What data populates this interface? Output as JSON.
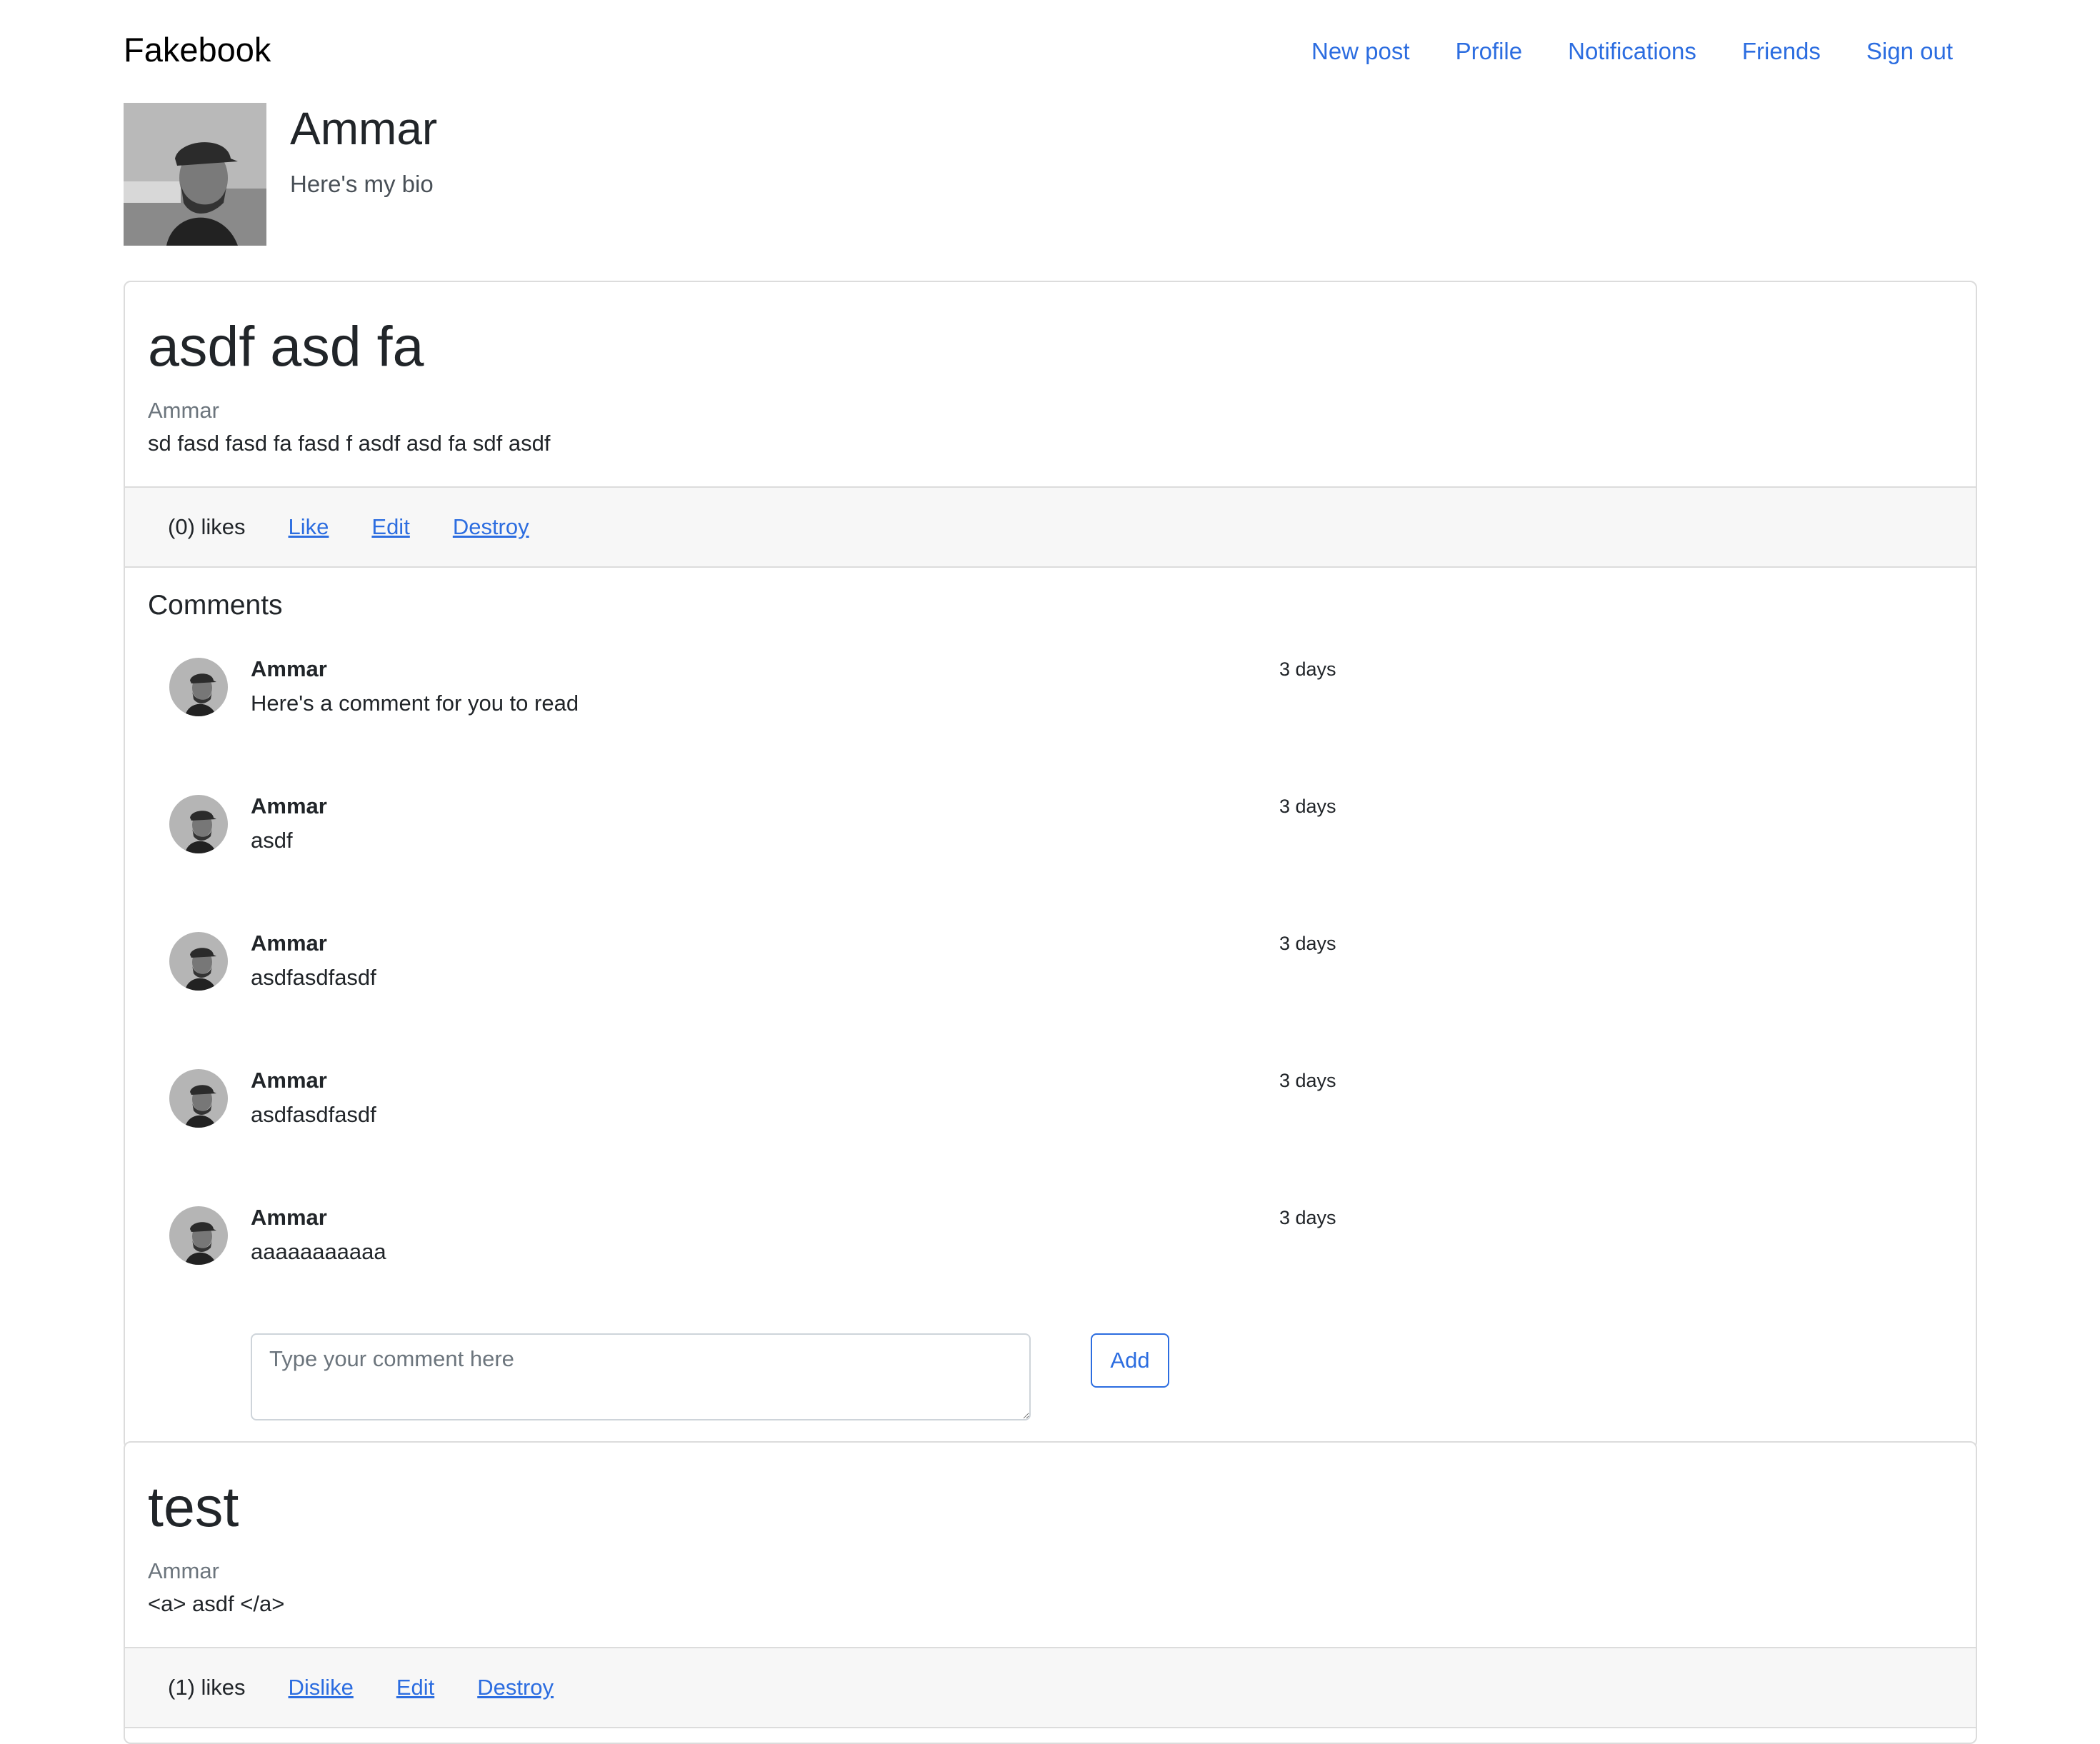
{
  "navbar": {
    "brand": "Fakebook",
    "links": [
      "New post",
      "Profile",
      "Notifications",
      "Friends",
      "Sign out"
    ]
  },
  "profile": {
    "name": "Ammar",
    "bio": "Here's my bio"
  },
  "posts": [
    {
      "title": "asdf asd fa",
      "author": "Ammar",
      "body": "sd fasd fasd fa fasd f asdf asd fa sdf asdf",
      "likes": "(0) likes",
      "actions": [
        "Like",
        "Edit",
        "Destroy"
      ],
      "comments_title": "Comments",
      "comments": [
        {
          "author": "Ammar",
          "text": "Here's a comment for you to read",
          "time": "3 days"
        },
        {
          "author": "Ammar",
          "text": "asdf",
          "time": "3 days"
        },
        {
          "author": "Ammar",
          "text": "asdfasdfasdf",
          "time": "3 days"
        },
        {
          "author": "Ammar",
          "text": "asdfasdfasdf",
          "time": "3 days"
        },
        {
          "author": "Ammar",
          "text": "aaaaaaaaaaa",
          "time": "3 days"
        }
      ],
      "comment_placeholder": "Type your comment here",
      "add_label": "Add"
    },
    {
      "title": "test",
      "author": "Ammar",
      "body": "<a> asdf </a>",
      "likes": "(1) likes",
      "actions": [
        "Dislike",
        "Edit",
        "Destroy"
      ]
    }
  ]
}
